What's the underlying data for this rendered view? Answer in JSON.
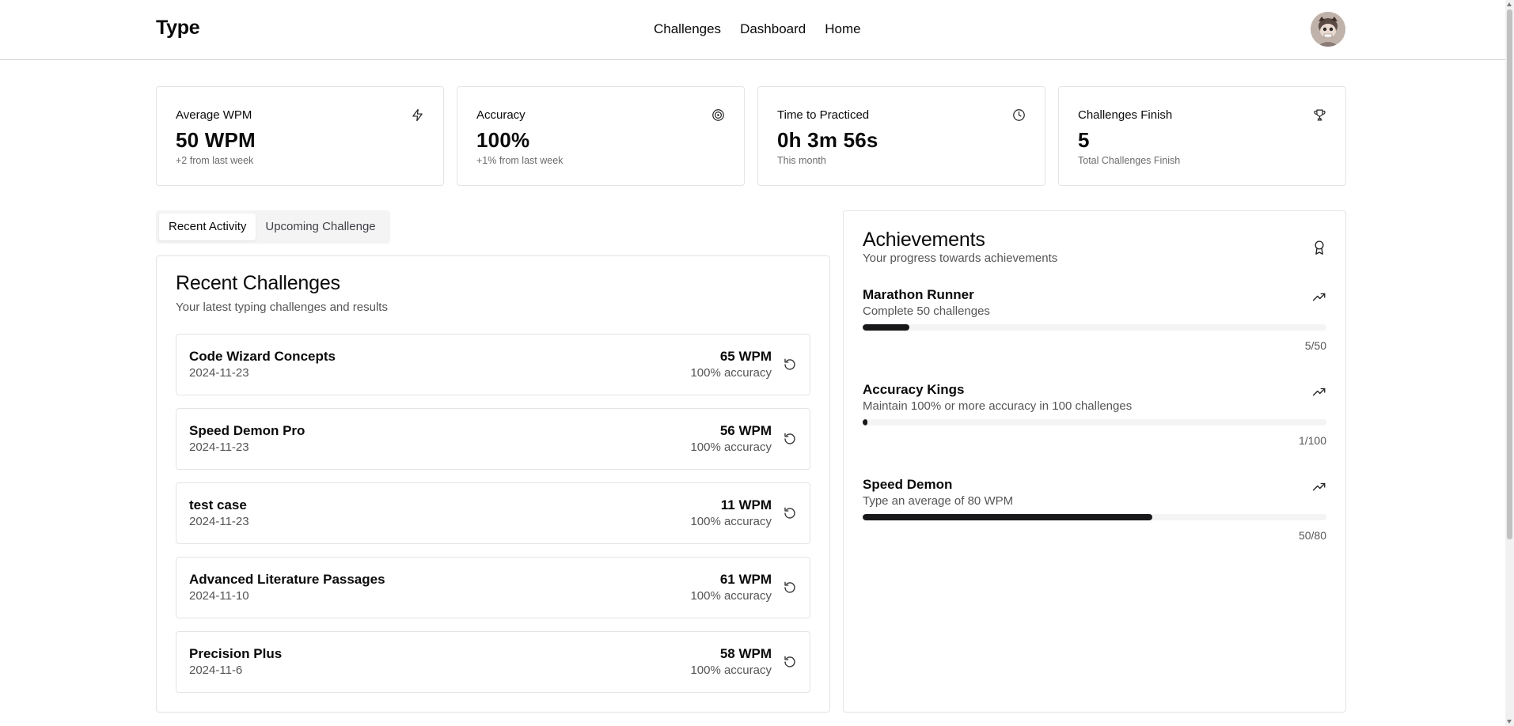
{
  "header": {
    "brand": "Type",
    "nav": [
      "Challenges",
      "Dashboard",
      "Home"
    ],
    "avatar_icon": "user-avatar"
  },
  "stats": [
    {
      "title": "Average WPM",
      "value": "50 WPM",
      "sub": "+2 from last week",
      "icon": "zap-icon"
    },
    {
      "title": "Accuracy",
      "value": "100%",
      "sub": "+1% from last week",
      "icon": "target-icon"
    },
    {
      "title": "Time to Practiced",
      "value": "0h 3m 56s",
      "sub": "This month",
      "icon": "clock-icon"
    },
    {
      "title": "Challenges Finish",
      "value": "5",
      "sub": "Total Challenges Finish",
      "icon": "trophy-icon"
    }
  ],
  "tabs": {
    "recent": "Recent Activity",
    "upcoming": "Upcoming Challenge",
    "active": "recent"
  },
  "recent": {
    "title": "Recent Challenges",
    "subtitle": "Your latest typing challenges and results",
    "items": [
      {
        "name": "Code Wizard Concepts",
        "date": "2024-11-23",
        "wpm": "65 WPM",
        "accuracy": "100% accuracy"
      },
      {
        "name": "Speed Demon Pro",
        "date": "2024-11-23",
        "wpm": "56 WPM",
        "accuracy": "100% accuracy"
      },
      {
        "name": "test case",
        "date": "2024-11-23",
        "wpm": "11 WPM",
        "accuracy": "100% accuracy"
      },
      {
        "name": "Advanced Literature Passages",
        "date": "2024-11-10",
        "wpm": "61 WPM",
        "accuracy": "100% accuracy"
      },
      {
        "name": "Precision Plus",
        "date": "2024-11-6",
        "wpm": "58 WPM",
        "accuracy": "100% accuracy"
      }
    ]
  },
  "achievements": {
    "title": "Achievements",
    "subtitle": "Your progress towards achievements",
    "items": [
      {
        "name": "Marathon Runner",
        "description": "Complete 50 challenges",
        "progress": "5/50",
        "fraction": 0.1
      },
      {
        "name": "Accuracy Kings",
        "description": "Maintain 100% or more accuracy in 100 challenges",
        "progress": "1/100",
        "fraction": 0.01
      },
      {
        "name": "Speed Demon",
        "description": "Type an average of 80 WPM",
        "progress": "50/80",
        "fraction": 0.625
      }
    ]
  },
  "colors": {
    "accent": "#18181b",
    "border": "#e4e4e7",
    "muted_text": "#555555",
    "track": "#f4f4f5"
  }
}
